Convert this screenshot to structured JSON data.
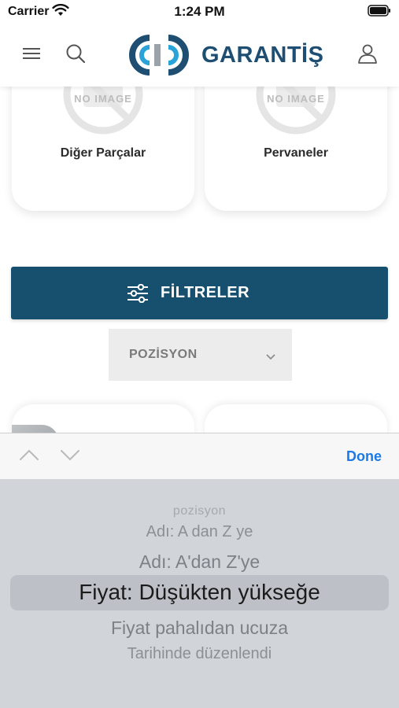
{
  "status_bar": {
    "carrier": "Carrier",
    "time": "1:24 PM"
  },
  "header": {
    "logo_text": "GARANTİŞ",
    "brand_color": "#1e4f73",
    "accent_color": "#2aa3d8",
    "icons": [
      "menu-icon",
      "search-icon",
      "user-icon"
    ]
  },
  "categories": [
    {
      "placeholder": "NO IMAGE",
      "label": "Diğer Parçalar"
    },
    {
      "placeholder": "NO IMAGE",
      "label": "Pervaneler"
    }
  ],
  "filter_button": {
    "label": "FİLTRELER",
    "color": "#17506f"
  },
  "sort_select": {
    "value": "POZİSYON"
  },
  "accessory_bar": {
    "done_label": "Done",
    "done_color": "#1a7ae8"
  },
  "picker": {
    "options": [
      "pozisyon",
      "Adı: A dan Z ye",
      "Adı: A'dan Z'ye",
      "Fiyat: Düşükten yükseğe",
      "Fiyat pahalıdan ucuza",
      "Tarihinde düzenlendi"
    ],
    "selected_index": 3
  }
}
